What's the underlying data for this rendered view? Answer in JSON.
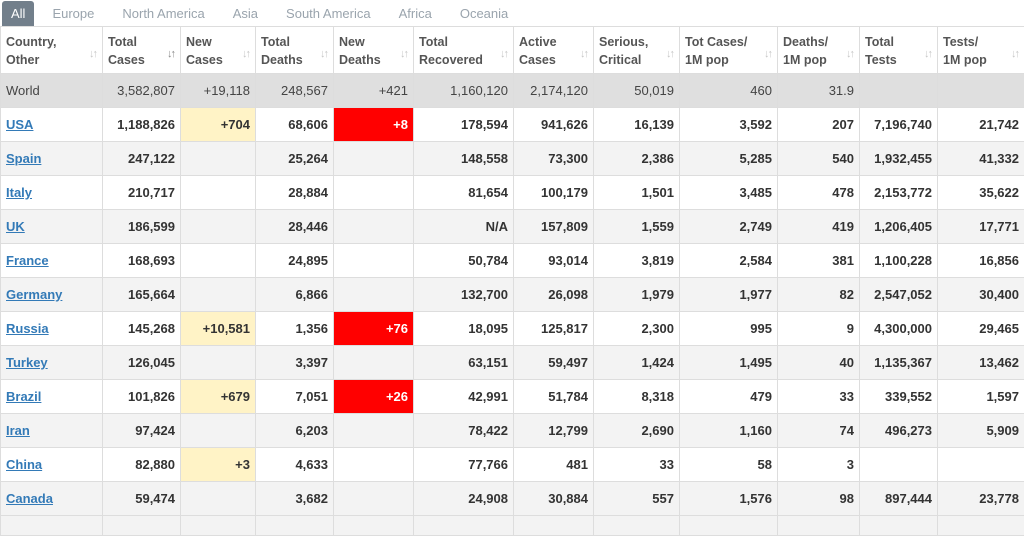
{
  "tabs": [
    "All",
    "Europe",
    "North America",
    "Asia",
    "South America",
    "Africa",
    "Oceania"
  ],
  "active_tab": "All",
  "colors": {
    "new_cases_highlight": "#fff3c6",
    "new_deaths_highlight": "#ff0000",
    "link": "#337ab7",
    "world_row_bg": "#dfdfdf"
  },
  "columns": [
    {
      "line1": "Country,",
      "line2": "Other"
    },
    {
      "line1": "Total",
      "line2": "Cases"
    },
    {
      "line1": "New",
      "line2": "Cases"
    },
    {
      "line1": "Total",
      "line2": "Deaths"
    },
    {
      "line1": "New",
      "line2": "Deaths"
    },
    {
      "line1": "Total",
      "line2": "Recovered"
    },
    {
      "line1": "Active",
      "line2": "Cases"
    },
    {
      "line1": "Serious,",
      "line2": "Critical"
    },
    {
      "line1": "Tot Cases/",
      "line2": "1M pop"
    },
    {
      "line1": "Deaths/",
      "line2": "1M pop"
    },
    {
      "line1": "Total",
      "line2": "Tests"
    },
    {
      "line1": "Tests/",
      "line2": "1M pop"
    }
  ],
  "world": [
    "World",
    "3,582,807",
    "+19,118",
    "248,567",
    "+421",
    "1,160,120",
    "2,174,120",
    "50,019",
    "460",
    "31.9",
    "",
    ""
  ],
  "rows": [
    [
      "USA",
      "1,188,826",
      "+704",
      "68,606",
      "+8",
      "178,594",
      "941,626",
      "16,139",
      "3,592",
      "207",
      "7,196,740",
      "21,742"
    ],
    [
      "Spain",
      "247,122",
      "",
      "25,264",
      "",
      "148,558",
      "73,300",
      "2,386",
      "5,285",
      "540",
      "1,932,455",
      "41,332"
    ],
    [
      "Italy",
      "210,717",
      "",
      "28,884",
      "",
      "81,654",
      "100,179",
      "1,501",
      "3,485",
      "478",
      "2,153,772",
      "35,622"
    ],
    [
      "UK",
      "186,599",
      "",
      "28,446",
      "",
      "N/A",
      "157,809",
      "1,559",
      "2,749",
      "419",
      "1,206,405",
      "17,771"
    ],
    [
      "France",
      "168,693",
      "",
      "24,895",
      "",
      "50,784",
      "93,014",
      "3,819",
      "2,584",
      "381",
      "1,100,228",
      "16,856"
    ],
    [
      "Germany",
      "165,664",
      "",
      "6,866",
      "",
      "132,700",
      "26,098",
      "1,979",
      "1,977",
      "82",
      "2,547,052",
      "30,400"
    ],
    [
      "Russia",
      "145,268",
      "+10,581",
      "1,356",
      "+76",
      "18,095",
      "125,817",
      "2,300",
      "995",
      "9",
      "4,300,000",
      "29,465"
    ],
    [
      "Turkey",
      "126,045",
      "",
      "3,397",
      "",
      "63,151",
      "59,497",
      "1,424",
      "1,495",
      "40",
      "1,135,367",
      "13,462"
    ],
    [
      "Brazil",
      "101,826",
      "+679",
      "7,051",
      "+26",
      "42,991",
      "51,784",
      "8,318",
      "479",
      "33",
      "339,552",
      "1,597"
    ],
    [
      "Iran",
      "97,424",
      "",
      "6,203",
      "",
      "78,422",
      "12,799",
      "2,690",
      "1,160",
      "74",
      "496,273",
      "5,909"
    ],
    [
      "China",
      "82,880",
      "+3",
      "4,633",
      "",
      "77,766",
      "481",
      "33",
      "58",
      "3",
      "",
      ""
    ],
    [
      "Canada",
      "59,474",
      "",
      "3,682",
      "",
      "24,908",
      "30,884",
      "557",
      "1,576",
      "98",
      "897,444",
      "23,778"
    ]
  ]
}
